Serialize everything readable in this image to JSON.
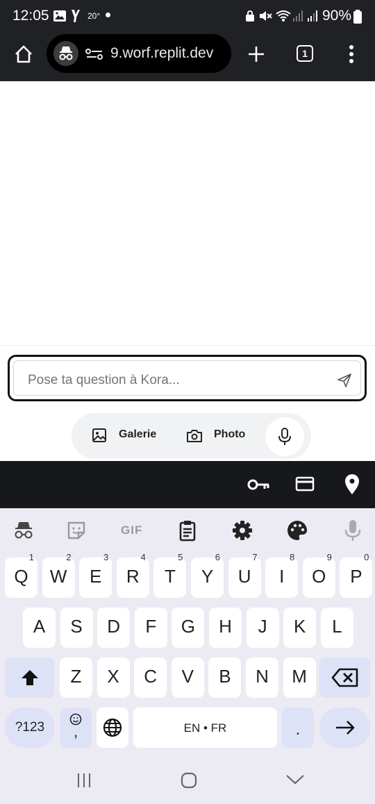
{
  "status_bar": {
    "time": "12:05",
    "temperature": "20°",
    "battery": "90%"
  },
  "browser": {
    "url": "9.worf.replit.dev",
    "tab_count": "1"
  },
  "composer": {
    "placeholder": "Pose ta question à Kora...",
    "gallery_label": "Galerie",
    "photo_label": "Photo"
  },
  "keyboard": {
    "row1": [
      {
        "label": "Q",
        "hint": "1"
      },
      {
        "label": "W",
        "hint": "2"
      },
      {
        "label": "E",
        "hint": "3"
      },
      {
        "label": "R",
        "hint": "4"
      },
      {
        "label": "T",
        "hint": "5"
      },
      {
        "label": "Y",
        "hint": "6"
      },
      {
        "label": "U",
        "hint": "7"
      },
      {
        "label": "I",
        "hint": "8"
      },
      {
        "label": "O",
        "hint": "9"
      },
      {
        "label": "P",
        "hint": "0"
      }
    ],
    "row2": [
      "A",
      "S",
      "D",
      "F",
      "G",
      "H",
      "J",
      "K",
      "L"
    ],
    "row3": [
      "Z",
      "X",
      "C",
      "V",
      "B",
      "N",
      "M"
    ],
    "symbols_label": "?123",
    "emoji_comma": ",",
    "space_label": "EN • FR",
    "period": ".",
    "gif_label": "GIF"
  }
}
